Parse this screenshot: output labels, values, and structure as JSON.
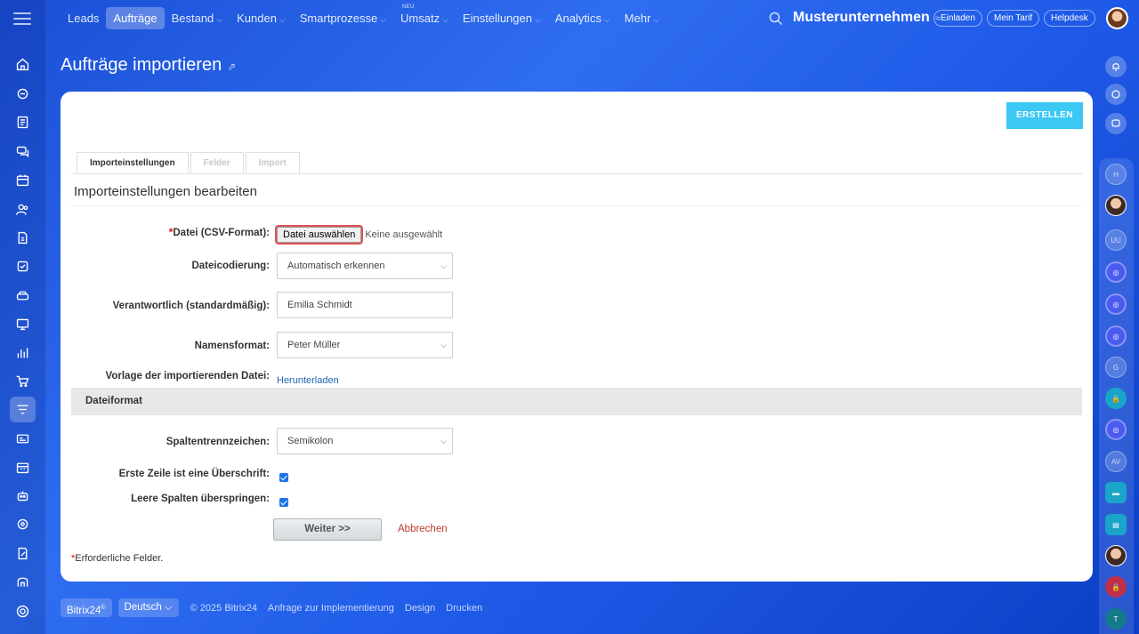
{
  "top_nav": {
    "items": [
      {
        "label": "Leads",
        "chevron": false
      },
      {
        "label": "Aufträge",
        "chevron": false,
        "active": true
      },
      {
        "label": "Bestand",
        "chevron": true
      },
      {
        "label": "Kunden",
        "chevron": true
      },
      {
        "label": "Smartprozesse",
        "chevron": true
      },
      {
        "label": "Umsatz",
        "chevron": true,
        "badge": "NEU"
      },
      {
        "label": "Einstellungen",
        "chevron": true
      },
      {
        "label": "Analytics",
        "chevron": true
      },
      {
        "label": "Mehr",
        "chevron": true
      }
    ],
    "company": "Musterunternehmen",
    "invite": "Einladen",
    "plan": "Mein Tarif",
    "helpdesk": "Helpdesk"
  },
  "page": {
    "title": "Aufträge importieren",
    "create_button": "ERSTELLEN"
  },
  "tabs": [
    {
      "label": "Importeinstellungen",
      "active": true
    },
    {
      "label": "Felder",
      "active": false
    },
    {
      "label": "Import",
      "active": false
    }
  ],
  "form": {
    "section_title": "Importeinstellungen bearbeiten",
    "file_label": "Datei (CSV-Format):",
    "file_button": "Datei auswählen",
    "file_none": "Keine ausgewählt",
    "encoding_label": "Dateicodierung:",
    "encoding_value": "Automatisch erkennen",
    "responsible_label": "Verantwortlich (standardmäßig):",
    "responsible_value": "Emilia Schmidt",
    "name_format_label": "Namensformat:",
    "name_format_value": "Peter Müller",
    "template_label": "Vorlage der importierenden Datei:",
    "template_link": "Herunterladen",
    "format_section": "Dateiformat",
    "separator_label": "Spaltentrennzeichen:",
    "separator_value": "Semikolon",
    "header_row_label": "Erste Zeile ist eine Überschrift:",
    "skip_empty_label": "Leere Spalten überspringen:",
    "next_button": "Weiter >>",
    "cancel_link": "Abbrechen",
    "required_note": "Erforderliche Felder."
  },
  "footer": {
    "brand": "Bitrix24",
    "brand_mark": "©",
    "language": "Deutsch",
    "copyright": "© 2025 Bitrix24",
    "implementation": "Anfrage zur Implementierung",
    "design": "Design",
    "print": "Drucken"
  },
  "right_bar": {
    "initials": [
      "H",
      "UU",
      "G",
      "AV",
      "T"
    ]
  },
  "colors": {
    "accent": "#3bc8f5",
    "link": "#2067b0",
    "cancel": "#c0392b",
    "checkbox": "#1a73e8"
  }
}
